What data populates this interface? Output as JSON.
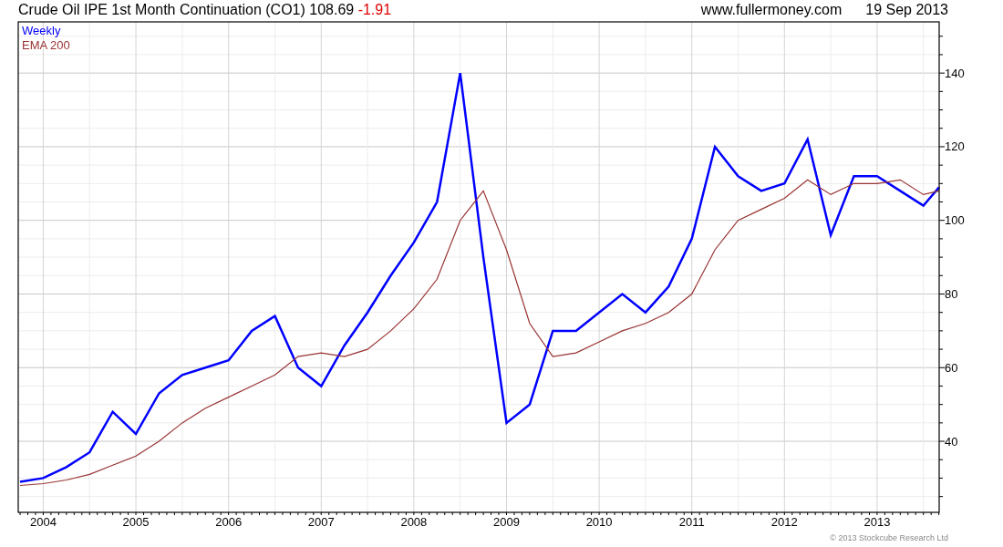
{
  "header": {
    "title": "Crude Oil IPE 1st Month Continuation (CO1) 108.69",
    "change": "-1.91",
    "source": "www.fullermoney.com",
    "date": "19 Sep 2013"
  },
  "chart": {
    "chart_data": {
      "type": "line",
      "x": [
        2003.75,
        2004,
        2004.25,
        2004.5,
        2004.75,
        2005,
        2005.25,
        2005.5,
        2005.75,
        2006,
        2006.25,
        2006.5,
        2006.75,
        2007,
        2007.25,
        2007.5,
        2007.75,
        2008,
        2008.25,
        2008.5,
        2008.75,
        2009,
        2009.25,
        2009.5,
        2009.75,
        2010,
        2010.25,
        2010.5,
        2010.75,
        2011,
        2011.25,
        2011.5,
        2011.75,
        2012,
        2012.25,
        2012.5,
        2012.75,
        2013,
        2013.25,
        2013.5,
        2013.67
      ],
      "series": [
        {
          "name": "Weekly",
          "color": "#0000ff",
          "values": [
            29,
            30,
            33,
            37,
            48,
            42,
            53,
            58,
            60,
            62,
            70,
            74,
            60,
            55,
            66,
            75,
            85,
            94,
            105,
            140,
            90,
            45,
            50,
            70,
            70,
            75,
            80,
            75,
            82,
            95,
            120,
            112,
            108,
            110,
            122,
            96,
            112,
            112,
            108,
            104,
            109
          ]
        },
        {
          "name": "EMA 200",
          "color": "#993333",
          "values": [
            28,
            28.5,
            29.5,
            31,
            33.5,
            36,
            40,
            45,
            49,
            52,
            55,
            58,
            63,
            64,
            63,
            65,
            70,
            76,
            84,
            100,
            108,
            92,
            72,
            63,
            64,
            67,
            70,
            72,
            75,
            80,
            92,
            100,
            103,
            106,
            111,
            107,
            110,
            110,
            111,
            107,
            108
          ]
        }
      ],
      "xlim": [
        2003.73,
        2013.67
      ],
      "ylim": [
        20.7,
        153.9
      ],
      "grid": true,
      "xticks": [
        2004,
        2005,
        2006,
        2007,
        2008,
        2009,
        2010,
        2011,
        2012,
        2013
      ],
      "yticks": [
        40,
        60,
        80,
        100,
        120,
        140
      ]
    }
  },
  "footer": {
    "copyright": "© 2013 Stockcube Research Ltd"
  }
}
